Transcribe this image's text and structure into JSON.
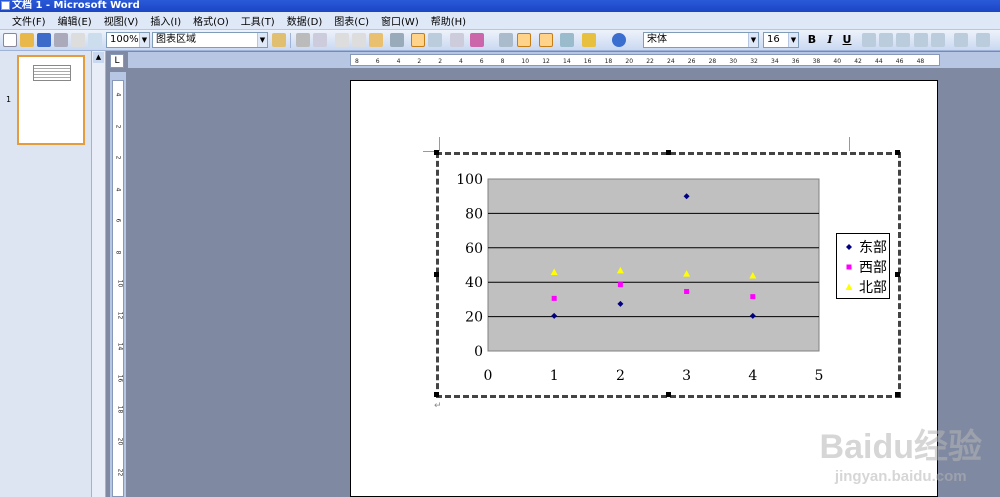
{
  "window": {
    "title": "文档 1 - Microsoft Word"
  },
  "menu": [
    "文件(F)",
    "编辑(E)",
    "视图(V)",
    "插入(I)",
    "格式(O)",
    "工具(T)",
    "数据(D)",
    "图表(C)",
    "窗口(W)",
    "帮助(H)"
  ],
  "toolbar": {
    "zoom": "100%",
    "chart_object": "图表区域",
    "font_name": "宋体",
    "font_size": "16",
    "bold": "B",
    "italic": "I",
    "underline": "U"
  },
  "thumbnail": {
    "page_number": "1"
  },
  "hruler_ticks": [
    "8",
    "6",
    "4",
    "2",
    "2",
    "4",
    "6",
    "8",
    "10",
    "12",
    "14",
    "16",
    "18",
    "20",
    "22",
    "24",
    "26",
    "28",
    "30",
    "32",
    "34",
    "36",
    "38",
    "40",
    "42",
    "44",
    "46",
    "48"
  ],
  "vruler_ticks": [
    "4",
    "2",
    "2",
    "4",
    "6",
    "8",
    "10",
    "12",
    "14",
    "16",
    "18",
    "20",
    "22"
  ],
  "watermark": {
    "brand": "Baidu经验",
    "url": "jingyan.baidu.com"
  },
  "colors": {
    "east": "#000080",
    "west": "#ff00ff",
    "north": "#ffff00",
    "plot_bg": "#c0c0c0"
  },
  "chart_data": {
    "type": "scatter",
    "title": "",
    "xlabel": "",
    "ylabel": "",
    "xlim": [
      0,
      5
    ],
    "ylim": [
      0,
      100
    ],
    "x_ticks": [
      "0",
      "1",
      "2",
      "3",
      "4",
      "5"
    ],
    "y_ticks": [
      "0",
      "20",
      "40",
      "60",
      "80",
      "100"
    ],
    "grid": "horizontal",
    "legend_placement": "right",
    "series": [
      {
        "name": "东部",
        "marker": "diamond",
        "points": [
          [
            1,
            20.4
          ],
          [
            2,
            27.4
          ],
          [
            3,
            90
          ],
          [
            4,
            20.4
          ]
        ]
      },
      {
        "name": "西部",
        "marker": "square",
        "points": [
          [
            1,
            30.6
          ],
          [
            2,
            38.6
          ],
          [
            3,
            34.6
          ],
          [
            4,
            31.6
          ]
        ]
      },
      {
        "name": "北部",
        "marker": "triangle",
        "points": [
          [
            1,
            45.9
          ],
          [
            2,
            46.9
          ],
          [
            3,
            45
          ],
          [
            4,
            43.9
          ]
        ]
      }
    ]
  }
}
